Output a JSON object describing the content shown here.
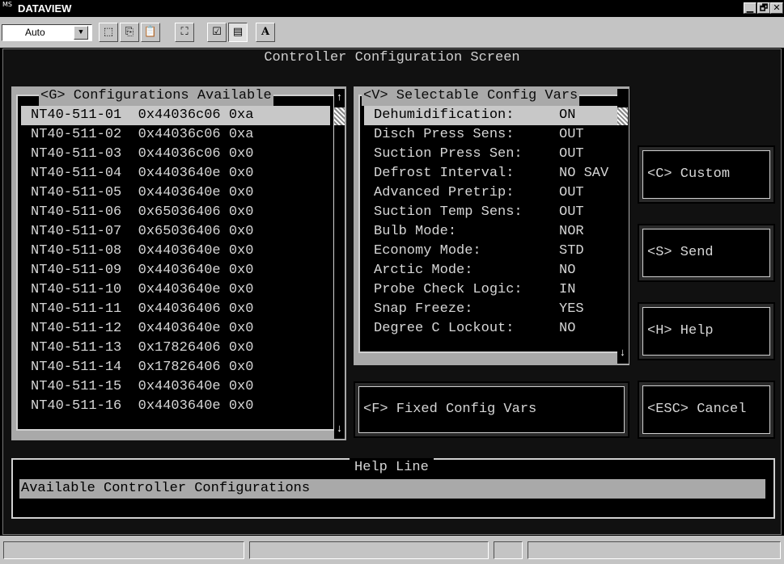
{
  "window": {
    "title": "DATAVIEW",
    "app_icon_text": "MS",
    "controls": {
      "minimize": "▁",
      "restore": "🗗",
      "close": "✕"
    }
  },
  "toolbar": {
    "font_select_value": "Auto",
    "buttons": [
      {
        "icon": "select-rect-icon",
        "glyph": "⬚"
      },
      {
        "icon": "copy-icon",
        "glyph": "⎘"
      },
      {
        "icon": "paste-icon",
        "glyph": "📋"
      },
      {
        "icon": "full-screen-icon",
        "glyph": "⛶"
      },
      {
        "icon": "properties-icon",
        "glyph": "☑"
      },
      {
        "icon": "background-icon",
        "glyph": "▤"
      },
      {
        "icon": "font-icon",
        "glyph": "A"
      }
    ]
  },
  "screen": {
    "title": "Controller Configuration Screen"
  },
  "configurations": {
    "title": "<G> Configurations Available",
    "rows": [
      "NT40-511-01  0x44036c06 0xa",
      "NT40-511-02  0x44036c06 0xa",
      "NT40-511-03  0x44036c06 0x0",
      "NT40-511-04  0x4403640e 0x0",
      "NT40-511-05  0x4403640e 0x0",
      "NT40-511-06  0x65036406 0x0",
      "NT40-511-07  0x65036406 0x0",
      "NT40-511-08  0x4403640e 0x0",
      "NT40-511-09  0x4403640e 0x0",
      "NT40-511-10  0x4403640e 0x0",
      "NT40-511-11  0x44036406 0x0",
      "NT40-511-12  0x4403640e 0x0",
      "NT40-511-13  0x17826406 0x0",
      "NT40-511-14  0x17826406 0x0",
      "NT40-511-15  0x4403640e 0x0",
      "NT40-511-16  0x4403640e 0x0"
    ],
    "scroll_up": "↑",
    "scroll_down": "↓"
  },
  "selectable_vars": {
    "title": "<V> Selectable Config Vars",
    "rows": [
      {
        "label": "Dehumidification:",
        "value": "ON"
      },
      {
        "label": "Disch Press Sens:",
        "value": "OUT"
      },
      {
        "label": "Suction Press Sen:",
        "value": "OUT"
      },
      {
        "label": "Defrost Interval:",
        "value": "NO SAV"
      },
      {
        "label": "Advanced Pretrip:",
        "value": "OUT"
      },
      {
        "label": "Suction Temp Sens:",
        "value": "OUT"
      },
      {
        "label": "Bulb Mode:",
        "value": "NOR"
      },
      {
        "label": "Economy Mode:",
        "value": "STD"
      },
      {
        "label": "Arctic Mode:",
        "value": "NO"
      },
      {
        "label": "Probe Check Logic:",
        "value": "IN"
      },
      {
        "label": "Snap Freeze:",
        "value": "YES"
      },
      {
        "label": "Degree C Lockout:",
        "value": "NO"
      }
    ],
    "scroll_down": "↓"
  },
  "buttons": {
    "fixed_config": "<F> Fixed Config Vars",
    "custom": "<C> Custom",
    "send": "<S> Send",
    "help": "<H> Help",
    "cancel": "<ESC> Cancel"
  },
  "help_line": {
    "title": "Help Line",
    "text": "Available Controller Configurations"
  }
}
